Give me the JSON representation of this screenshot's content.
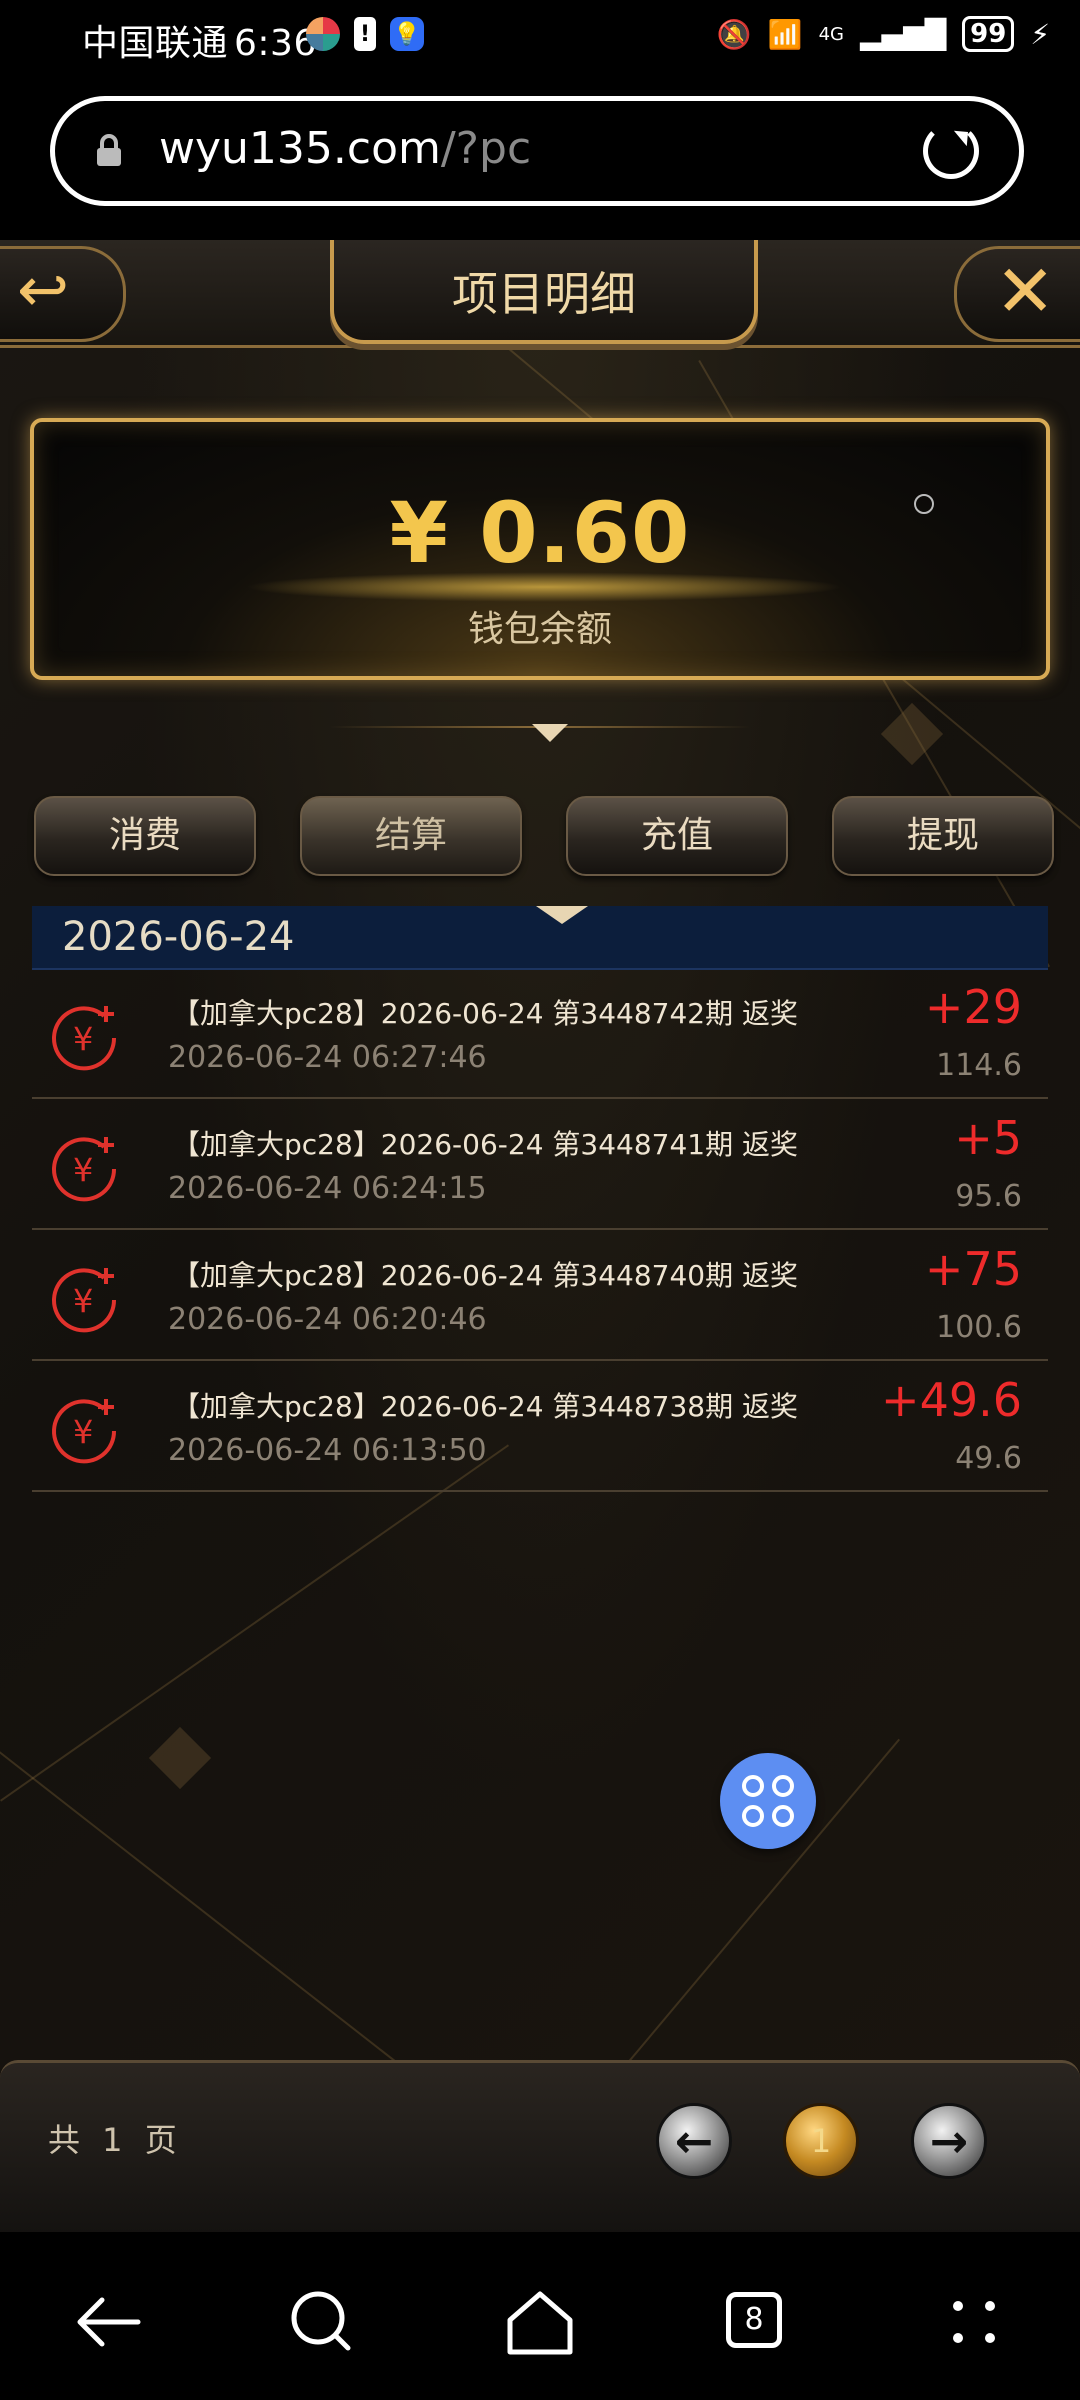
{
  "status_bar": {
    "carrier": "中国联通",
    "time": "6:36",
    "network": "4G",
    "battery": "99"
  },
  "browser": {
    "url_host": "wyu135.com",
    "url_path": "/?pc"
  },
  "header": {
    "title": "项目明细",
    "back_icon": "back-arrow-icon",
    "close_icon": "close-icon"
  },
  "balance": {
    "amount": "¥ 0.60",
    "label": "钱包余额"
  },
  "tabs": [
    {
      "label": "消费",
      "active": false
    },
    {
      "label": "结算",
      "active": true
    },
    {
      "label": "充值",
      "active": false
    },
    {
      "label": "提现",
      "active": false
    }
  ],
  "date_group": "2026-06-24",
  "records": [
    {
      "title": "【加拿大pc28】2026-06-24 第3448742期 返奖",
      "time": "2026-06-24 06:27:46",
      "amount": "+29",
      "balance": "114.6"
    },
    {
      "title": "【加拿大pc28】2026-06-24 第3448741期 返奖",
      "time": "2026-06-24 06:24:15",
      "amount": "+5",
      "balance": "95.6"
    },
    {
      "title": "【加拿大pc28】2026-06-24 第3448740期 返奖",
      "time": "2026-06-24 06:20:46",
      "amount": "+75",
      "balance": "100.6"
    },
    {
      "title": "【加拿大pc28】2026-06-24 第3448738期 返奖",
      "time": "2026-06-24 06:13:50",
      "amount": "+49.6",
      "balance": "49.6"
    }
  ],
  "pager": {
    "summary": "共 1 页",
    "current_page": "1",
    "prev_icon": "arrow-left-icon",
    "next_icon": "arrow-right-icon"
  },
  "nav_bar": {
    "tab_count": "8"
  },
  "colors": {
    "accent_gold": "#f3c64d",
    "amount_red": "#ee2b2b",
    "date_bar": "#0c1e3c",
    "fab_blue": "#5d8ef2"
  }
}
